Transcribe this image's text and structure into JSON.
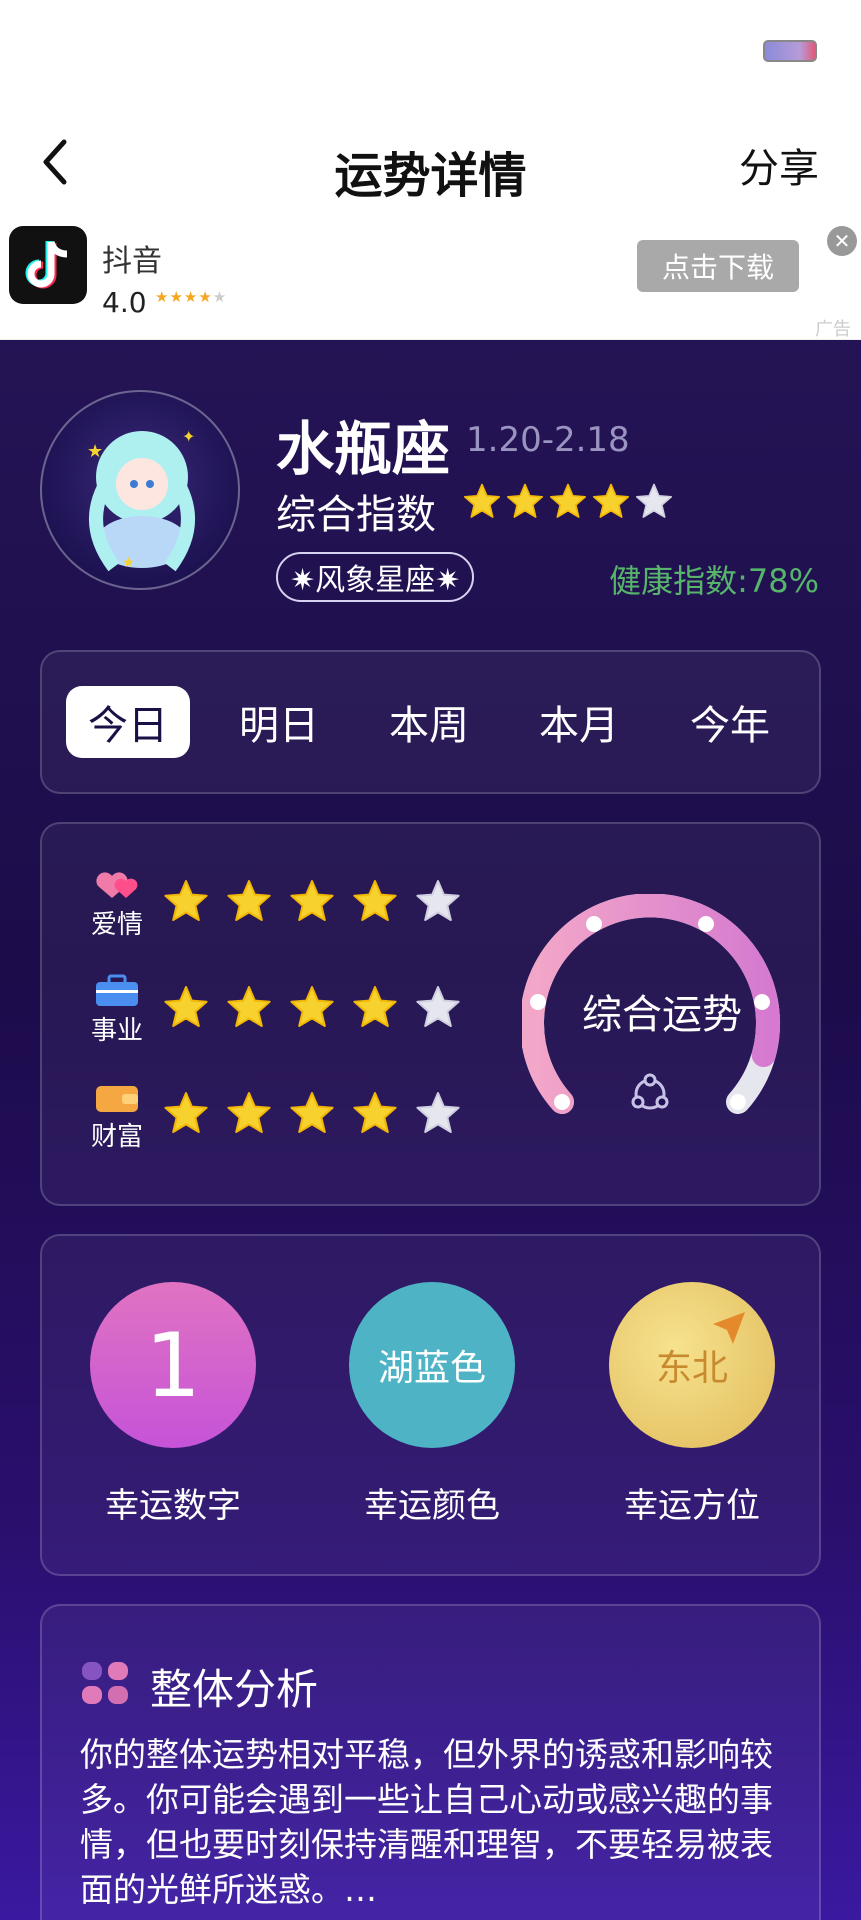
{
  "header": {
    "title": "运势详情",
    "share_label": "分享"
  },
  "ad": {
    "app_name": "抖音",
    "rating": "4.0",
    "rating_stars": 4,
    "download_label": "点击下载",
    "ad_label": "广告"
  },
  "sign": {
    "name": "水瓶座",
    "dates": "1.20-2.18",
    "overall_label": "综合指数",
    "overall_stars": 4,
    "element": "✷风象星座✷",
    "health": "健康指数:78%"
  },
  "tabs": [
    "今日",
    "明日",
    "本周",
    "本月",
    "今年"
  ],
  "active_tab": 0,
  "fortune": {
    "rows": [
      {
        "label": "爱情",
        "icon": "heart-icon",
        "stars": 4
      },
      {
        "label": "事业",
        "icon": "briefcase-icon",
        "stars": 4
      },
      {
        "label": "财富",
        "icon": "wallet-icon",
        "stars": 4
      }
    ],
    "gauge_label": "综合运势",
    "gauge_level": 0.9
  },
  "lucky": {
    "number": "1",
    "number_label": "幸运数字",
    "color": "湖蓝色",
    "color_label": "幸运颜色",
    "direction": "东北",
    "direction_label": "幸运方位"
  },
  "analysis": {
    "title": "整体分析",
    "text": "你的整体运势相对平稳，但外界的诱惑和影响较多。你可能会遇到一些让自己心动或感兴趣的事情，但也要时刻保持清醒和理智，不要轻易被表面的光鲜所迷惑。…"
  },
  "colors": {
    "background_top": "#241455",
    "background_bottom": "#3a19a0",
    "star_on": "#f7d12e",
    "star_off": "#e6e6ef",
    "health_green": "#56b56a",
    "lucky_number": "#d45fd0",
    "lucky_color": "#4fb3c6",
    "lucky_direction": "#e6c566"
  }
}
